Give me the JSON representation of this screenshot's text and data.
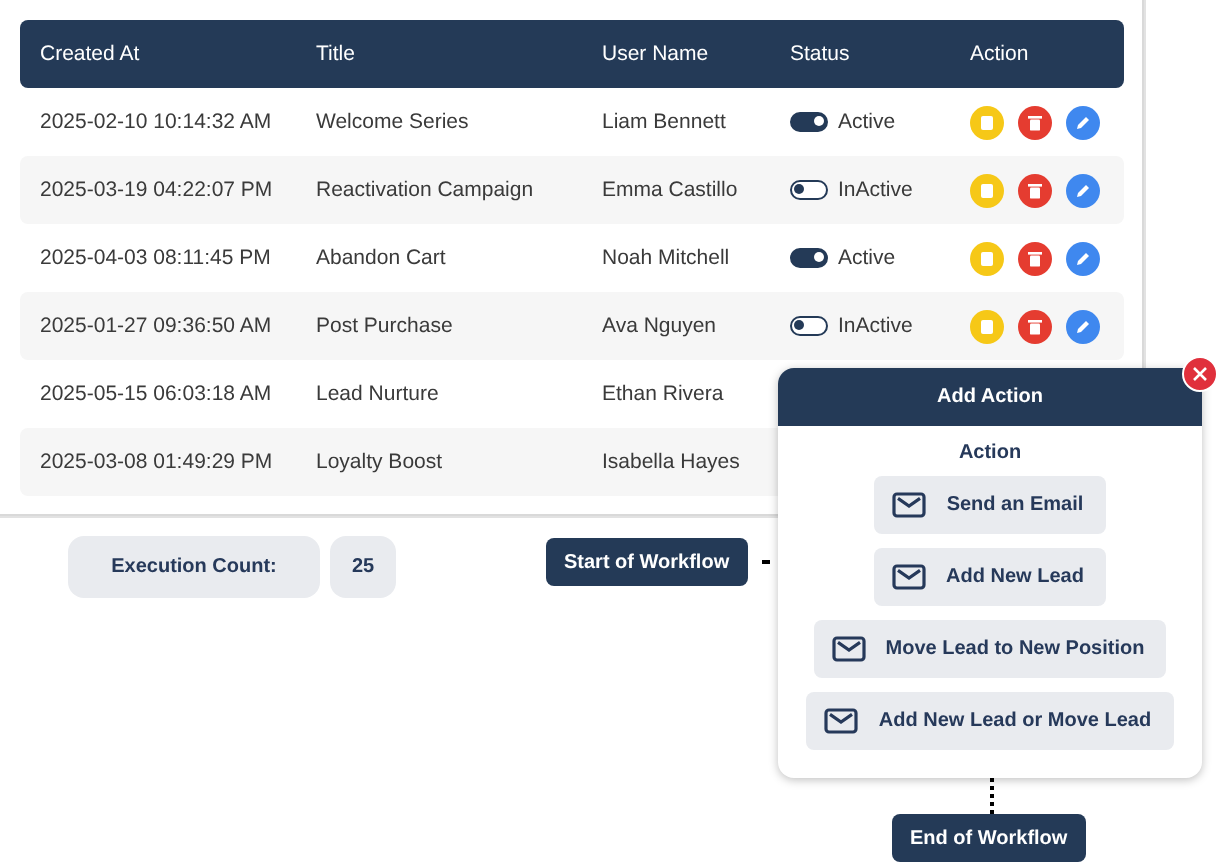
{
  "table": {
    "columns": [
      "Created At",
      "Title",
      "User Name",
      "Status",
      "Action"
    ],
    "rows": [
      {
        "created_at": "2025-02-10 10:14:32 AM",
        "title": "Welcome Series",
        "user_name": "Liam Bennett",
        "status": {
          "label": "Active",
          "on": true
        },
        "actions": [
          {
            "kind": "copy"
          },
          {
            "kind": "delete"
          },
          {
            "kind": "edit"
          }
        ]
      },
      {
        "created_at": "2025-03-19 04:22:07 PM",
        "title": "Reactivation Campaign",
        "user_name": "Emma Castillo",
        "status": {
          "label": "InActive",
          "on": false
        },
        "actions": [
          {
            "kind": "copy"
          },
          {
            "kind": "delete"
          },
          {
            "kind": "edit"
          }
        ]
      },
      {
        "created_at": "2025-04-03 08:11:45 PM",
        "title": "Abandon Cart",
        "user_name": "Noah Mitchell",
        "status": {
          "label": "Active",
          "on": true
        },
        "actions": [
          {
            "kind": "copy"
          },
          {
            "kind": "delete"
          },
          {
            "kind": "edit"
          }
        ]
      },
      {
        "created_at": "2025-01-27 09:36:50 AM",
        "title": "Post Purchase",
        "user_name": "Ava Nguyen",
        "status": {
          "label": "InActive",
          "on": false
        },
        "actions": [
          {
            "kind": "copy"
          },
          {
            "kind": "delete"
          },
          {
            "kind": "edit"
          }
        ]
      },
      {
        "created_at": "2025-05-15 06:03:18 AM",
        "title": "Lead Nurture",
        "user_name": "Ethan Rivera"
      },
      {
        "created_at": "2025-03-08 01:49:29 PM",
        "title": "Loyalty Boost",
        "user_name": "Isabella Hayes"
      }
    ]
  },
  "execution_count": {
    "label": "Execution Count:",
    "value": "25"
  },
  "workflow": {
    "start": "Start of Workflow",
    "end": "End of Workflow"
  },
  "popup": {
    "title": "Add Action",
    "section": "Action",
    "options": [
      "Send an Email",
      "Add New Lead",
      "Move Lead to New Position",
      "Add New Lead or Move Lead"
    ]
  }
}
